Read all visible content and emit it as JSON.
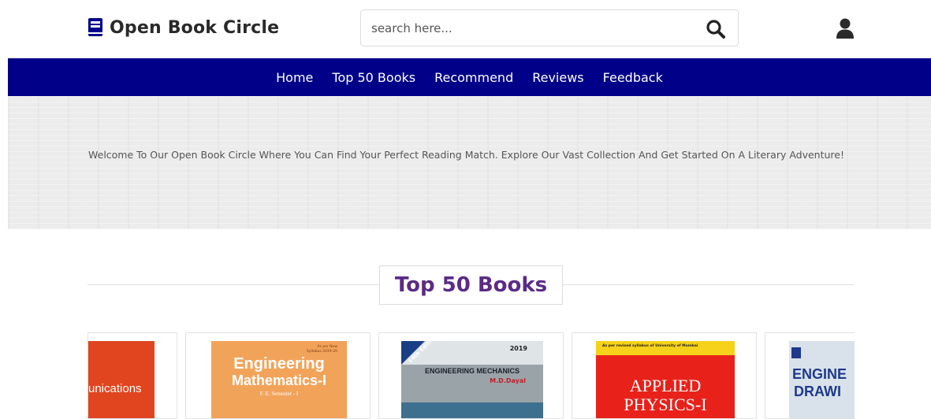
{
  "header": {
    "logo_text": "Open Book Circle",
    "search_placeholder": "search here...",
    "icons": {
      "logo": "book-icon",
      "search": "search-icon",
      "user": "user-icon"
    }
  },
  "nav": {
    "items": [
      "Home",
      "Top 50 Books",
      "Recommend",
      "Reviews",
      "Feedback"
    ]
  },
  "hero": {
    "text": "Welcome To Our Open Book Circle Where You Can Find Your Perfect Reading Match. Explore Our Vast Collection And Get Started On A Literary Adventure!"
  },
  "top_books": {
    "title": "Top 50 Books",
    "books": [
      {
        "cover_text": "unications"
      },
      {
        "cover_small": "As per New Syllabus 2019-20",
        "cover_title_1": "Engineering",
        "cover_title_2": "Mathematics-I",
        "cover_sub": "F. E. Semester - I"
      },
      {
        "cover_edition": "14th Edition",
        "cover_year": "2019",
        "cover_title": "ENGINEERING MECHANICS",
        "cover_author": "M.D.Dayal"
      },
      {
        "cover_small": "As per revised syllabus of University of Mumbai",
        "cover_title_1": "APPLIED",
        "cover_title_2": "PHYSICS-I"
      },
      {
        "cover_title_1": "ENGINE",
        "cover_title_2": "DRAWI"
      }
    ]
  },
  "colors": {
    "nav_bg": "#000088",
    "title": "#5b2a86"
  }
}
